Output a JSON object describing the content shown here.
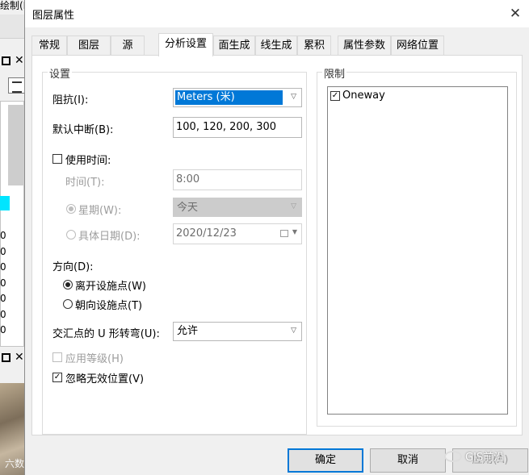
{
  "background_app": {
    "top_text": "绘制(D)",
    "digits": [
      "0",
      "0",
      "0",
      "0",
      "0",
      "0",
      "0",
      "0"
    ],
    "watermark": "六数路识"
  },
  "dialog": {
    "title": "图层属性",
    "close_glyph": "✕"
  },
  "tabs": [
    {
      "label": "常规"
    },
    {
      "label": "图层"
    },
    {
      "label": "源"
    },
    {
      "label": "分析设置"
    },
    {
      "label": "面生成"
    },
    {
      "label": "线生成"
    },
    {
      "label": "累积"
    },
    {
      "label": "属性参数"
    },
    {
      "label": "网络位置"
    }
  ],
  "settings": {
    "group_label": "设置",
    "impedance_label": "阻抗(I):",
    "impedance_value": "Meters (米)",
    "default_breaks_label": "默认中断(B):",
    "default_breaks_value": "100, 120, 200, 300",
    "use_time_label": "使用时间:",
    "time_label": "时间(T):",
    "time_value": "8:00",
    "weekday_label": "星期(W):",
    "weekday_value": "今天",
    "specific_date_label": "具体日期(D):",
    "specific_date_value": "2020/12/23",
    "direction_label": "方向(D):",
    "away_label": "离开设施点(W)",
    "toward_label": "朝向设施点(T)",
    "uturn_label": "交汇点的 U 形转弯(U):",
    "uturn_value": "允许",
    "hierarchy_label": "应用等级(H)",
    "ignore_invalid_label": "忽略无效位置(V)"
  },
  "restrictions": {
    "group_label": "限制",
    "items": [
      {
        "label": "Oneway"
      }
    ]
  },
  "buttons": {
    "ok": "确定",
    "cancel": "取消",
    "apply": "应用(A)"
  },
  "watermark": "GIS前沿",
  "colors": {
    "selection": "#0078d7",
    "dialog_bg": "#f0f0f0",
    "disabled_text": "#9d9d9d"
  },
  "icons": {
    "checkbox_checked": "check-icon",
    "dropdown": "chevron-down-icon",
    "close": "close-icon",
    "calendar": "calendar-icon"
  }
}
